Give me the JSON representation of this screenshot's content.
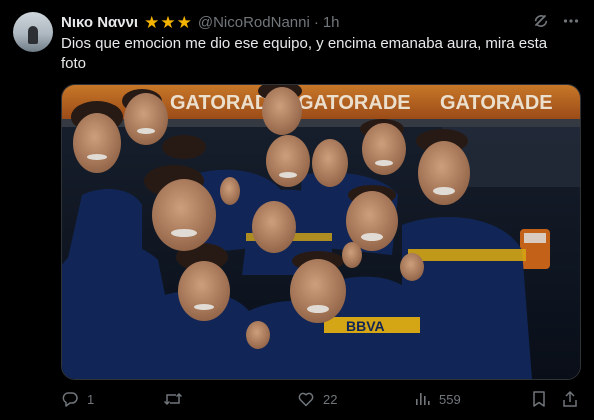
{
  "post": {
    "author_name": "Νικο Ναννι",
    "rating_icons": [
      "star-icon",
      "star-icon",
      "star-icon"
    ],
    "handle": "@NicoRodNanni",
    "separator": "·",
    "time": "1h",
    "text": "Dios que emocion me dio ese equipo, y encima emanaba aura, mira esta foto",
    "header_icons": [
      "grok-icon",
      "more-icon"
    ]
  },
  "media": {
    "banner_texts": [
      "GATORADE",
      "GATORADE",
      "GATORADE"
    ],
    "jersey_text": "BBVA"
  },
  "actions": {
    "reply_count": "1",
    "repost_count": "",
    "like_count": "22",
    "view_count": "559",
    "icons": [
      "reply-icon",
      "repost-icon",
      "like-icon",
      "views-icon",
      "bookmark-icon",
      "share-icon"
    ]
  },
  "colors": {
    "background": "#000000",
    "text_primary": "#e7e9ea",
    "text_secondary": "#71767b",
    "star": "#f4b400",
    "banner": "#c86a1a",
    "jersey_navy": "#132a5e",
    "jersey_gold": "#e7b416"
  }
}
